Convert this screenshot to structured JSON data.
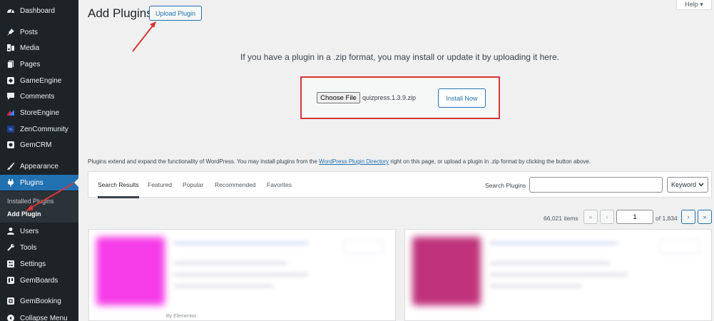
{
  "sidebar": {
    "items": [
      {
        "label": "Dashboard",
        "icon": "dashboard-icon"
      },
      {
        "label": "Posts",
        "icon": "pin-icon"
      },
      {
        "label": "Media",
        "icon": "media-icon"
      },
      {
        "label": "Pages",
        "icon": "pages-icon"
      },
      {
        "label": "GameEngine",
        "icon": "gameengine-icon"
      },
      {
        "label": "Comments",
        "icon": "comment-icon"
      },
      {
        "label": "StoreEngine",
        "icon": "storeengine-icon"
      },
      {
        "label": "ZenCommunity",
        "icon": "zencommunity-icon"
      },
      {
        "label": "GemCRM",
        "icon": "gemcrm-icon"
      },
      {
        "label": "Appearance",
        "icon": "brush-icon"
      },
      {
        "label": "Plugins",
        "icon": "plugin-icon"
      },
      {
        "label": "Users",
        "icon": "user-icon"
      },
      {
        "label": "Tools",
        "icon": "wrench-icon"
      },
      {
        "label": "Settings",
        "icon": "settings-icon"
      },
      {
        "label": "GemBoards",
        "icon": "gemboards-icon"
      },
      {
        "label": "GemBooking",
        "icon": "gembooking-icon"
      },
      {
        "label": "Collapse Menu",
        "icon": "collapse-icon"
      }
    ],
    "submenu": {
      "installed": "Installed Plugins",
      "add": "Add Plugin"
    },
    "accent_color": "#2271b1"
  },
  "header": {
    "title": "Add Plugins",
    "upload_button": "Upload Plugin",
    "help": "Help ▾"
  },
  "upload": {
    "help_text": "If you have a plugin in a .zip format, you may install or update it by uploading it here.",
    "choose_file": "Choose File",
    "file_name": "quizpress.1.3.9.zip",
    "install_button": "Install Now"
  },
  "description": {
    "before": "Plugins extend and expand the functionality of WordPress. You may install plugins from the ",
    "link": "WordPress Plugin Directory",
    "after": " right on this page, or upload a plugin in .zip format by clicking the button above."
  },
  "filters": {
    "tabs": [
      "Search Results",
      "Featured",
      "Popular",
      "Recommended",
      "Favorites"
    ],
    "search_label": "Search Plugins",
    "search_value": "",
    "keyword": "Keyword"
  },
  "pagination": {
    "items": "66,021 items",
    "first": "«",
    "prev": "‹",
    "current_page": "1",
    "of_pages": "of 1,834",
    "next": "›",
    "last": "»"
  },
  "cards": [
    {
      "author": "By Elementor"
    }
  ],
  "annotation_color": "#d63638"
}
